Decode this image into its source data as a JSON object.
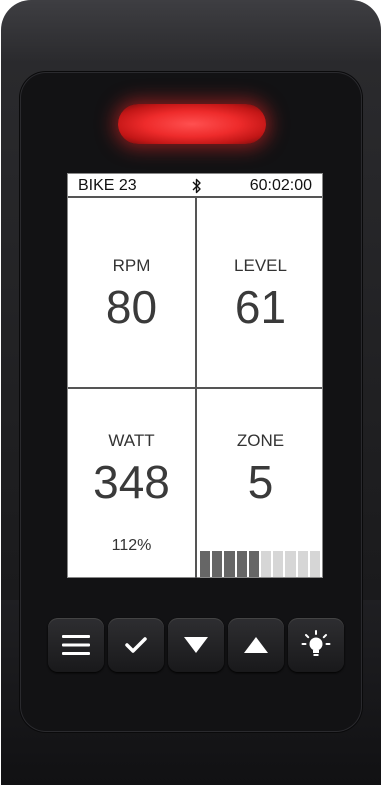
{
  "device": {
    "led_color": "#ee2b2b"
  },
  "screen": {
    "status": {
      "bike": "BIKE 23",
      "time": "60:02:00",
      "bluetooth_icon": "bluetooth-icon"
    },
    "cells": {
      "rpm": {
        "label": "RPM",
        "value": "80"
      },
      "level": {
        "label": "LEVEL",
        "value": "61"
      },
      "watt": {
        "label": "WATT",
        "value": "348",
        "percent": "112%"
      },
      "zone": {
        "label": "ZONE",
        "value": "5"
      }
    },
    "zone_bar": {
      "segments_total": 10,
      "segments_filled": 5,
      "filled_color": "#666666",
      "empty_color": "#d6d6d6"
    }
  },
  "buttons": [
    {
      "name": "menu-button",
      "icon": "menu-icon"
    },
    {
      "name": "confirm-button",
      "icon": "checkmark-icon"
    },
    {
      "name": "down-button",
      "icon": "triangle-down-icon"
    },
    {
      "name": "up-button",
      "icon": "triangle-up-icon"
    },
    {
      "name": "light-button",
      "icon": "lightbulb-icon"
    }
  ]
}
